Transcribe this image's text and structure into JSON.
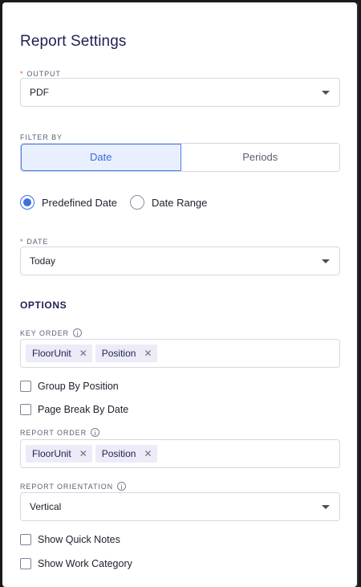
{
  "title": "Report Settings",
  "output": {
    "label": "OUTPUT",
    "required_mark": "*",
    "value": "PDF"
  },
  "filter_by": {
    "label": "FILTER BY",
    "options": [
      "Date",
      "Periods"
    ],
    "selected": "Date"
  },
  "date_mode": {
    "options": [
      "Predefined Date",
      "Date Range"
    ],
    "selected": "Predefined Date"
  },
  "date": {
    "label": "DATE",
    "required_mark": "*",
    "value": "Today"
  },
  "options_heading": "OPTIONS",
  "key_order": {
    "label": "KEY ORDER",
    "chips": [
      "FloorUnit",
      "Position"
    ]
  },
  "checkboxes_a": [
    {
      "label": "Group By Position",
      "checked": false
    },
    {
      "label": "Page Break By Date",
      "checked": false
    }
  ],
  "report_order": {
    "label": "REPORT ORDER",
    "chips": [
      "FloorUnit",
      "Position"
    ]
  },
  "report_orientation": {
    "label": "REPORT ORIENTATION",
    "value": "Vertical"
  },
  "checkboxes_b": [
    {
      "label": "Show Quick Notes",
      "checked": false
    },
    {
      "label": "Show Work Category",
      "checked": false
    }
  ],
  "chip_remove_glyph": "✕",
  "colors": {
    "primary": "#3f6fe0",
    "heading": "#1f2153",
    "required": "#e0443c",
    "active_bg": "#e8f0ff",
    "chip_bg": "#ecebf7"
  }
}
